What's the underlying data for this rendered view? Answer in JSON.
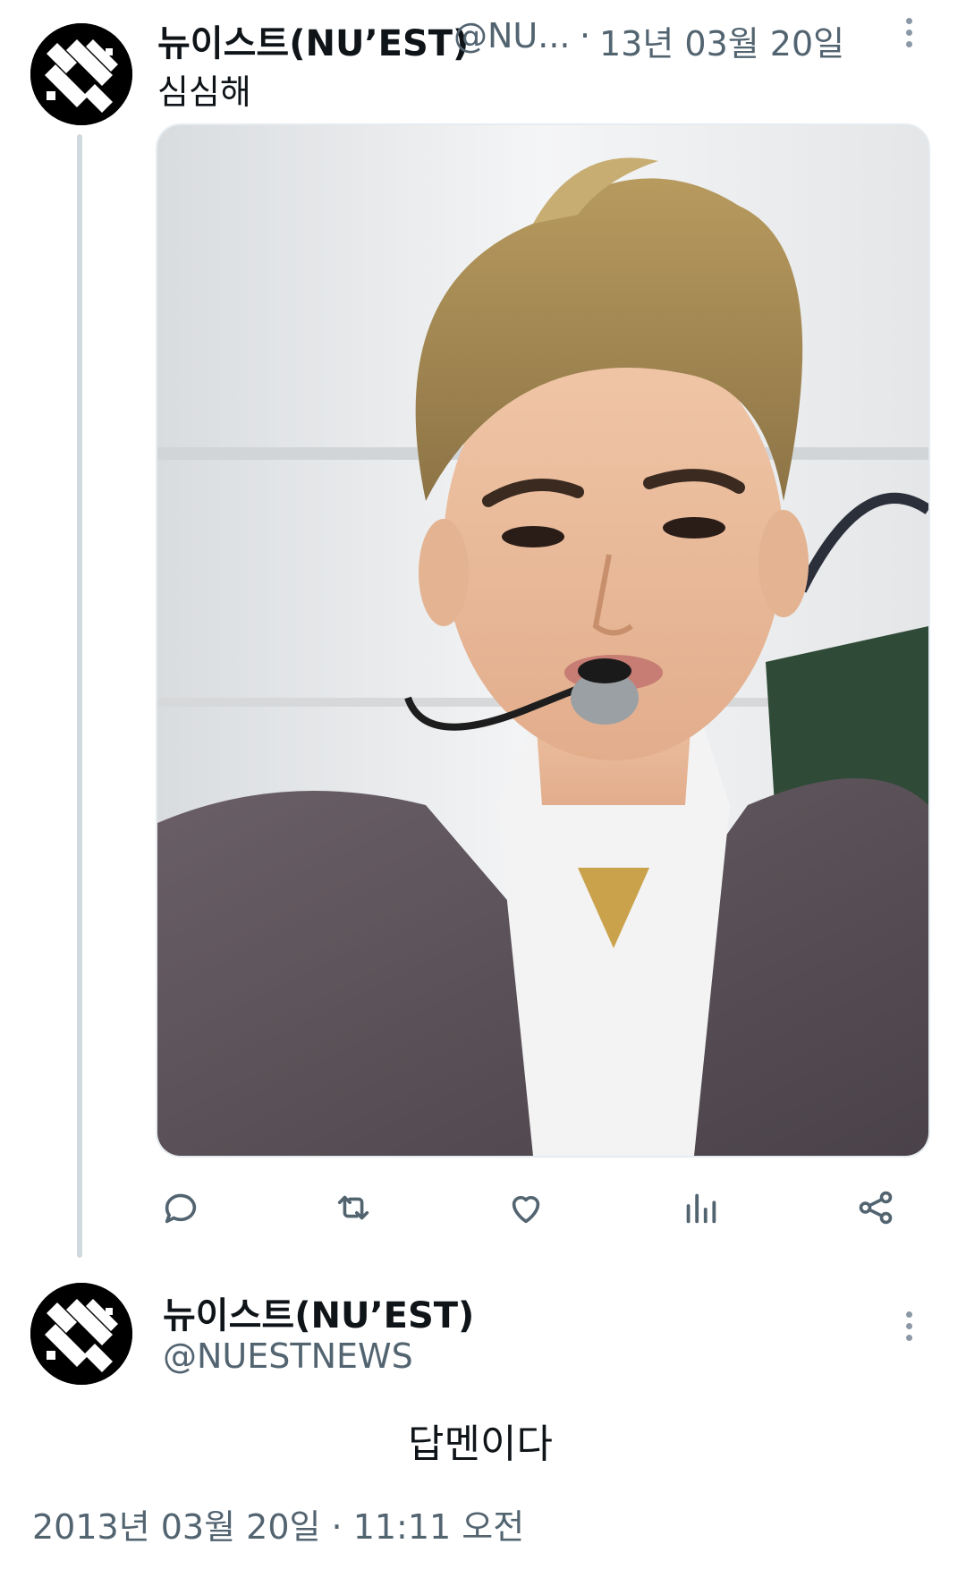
{
  "tweet1": {
    "display_name": "뉴이스트(NU’EST)",
    "handle": "@NU...",
    "separator": "·",
    "date": "13년 03월 20일",
    "text": "심심해",
    "media_description_icon": "photo",
    "actions": [
      "reply-icon",
      "retweet-icon",
      "like-icon",
      "views-icon",
      "share-icon"
    ]
  },
  "tweet2": {
    "display_name": "뉴이스트(NU’EST)",
    "handle": "@NUESTNEWS",
    "text": "답멘이다",
    "timestamp": "2013년 03월 20일 · 11:11 오전"
  },
  "colors": {
    "text_primary": "#0f1419",
    "text_secondary": "#536471",
    "thread_line": "#cfd9de"
  }
}
